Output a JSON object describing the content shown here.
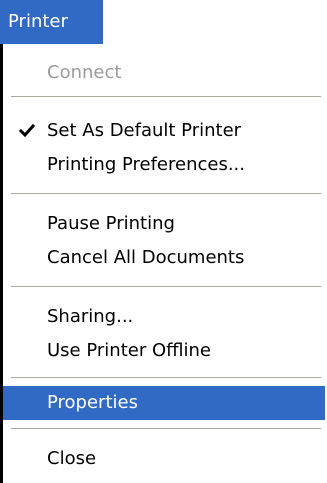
{
  "menu": {
    "title": "Printer",
    "accent_color": "#316ac5",
    "items": [
      {
        "label": "Connect",
        "disabled": true
      },
      {
        "label": "Set As Default Printer",
        "checked": true,
        "check_icon": "checkmark-icon"
      },
      {
        "label": "Printing Preferences..."
      },
      {
        "label": "Pause Printing"
      },
      {
        "label": "Cancel All Documents"
      },
      {
        "label": "Sharing..."
      },
      {
        "label": "Use Printer Offline"
      },
      {
        "label": "Properties",
        "highlighted": true
      },
      {
        "label": "Close"
      }
    ]
  }
}
